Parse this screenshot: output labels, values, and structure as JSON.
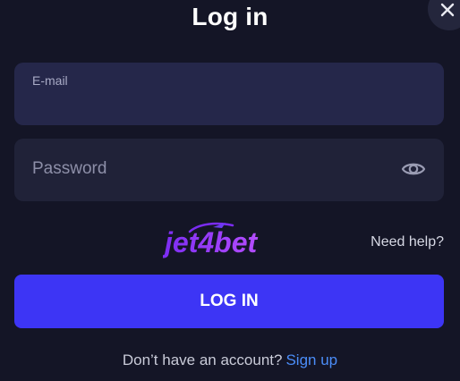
{
  "modal": {
    "title": "Log in",
    "close_icon": "close-icon"
  },
  "email": {
    "label": "E-mail",
    "value": ""
  },
  "password": {
    "placeholder": "Password",
    "value": "",
    "toggle_icon": "eye-icon"
  },
  "logo": {
    "text_part1": "jet",
    "text_part2": "4bet"
  },
  "help": {
    "label": "Need help?"
  },
  "login_button": {
    "label": "LOG IN"
  },
  "signup": {
    "prompt": "Don’t have an account?",
    "link": "Sign up"
  },
  "colors": {
    "background": "#141526",
    "field": "#25274a",
    "button": "#3d35f5",
    "link": "#4b8df8",
    "logo_gradient_start": "#7b2cf2",
    "logo_gradient_end": "#b44dff"
  }
}
